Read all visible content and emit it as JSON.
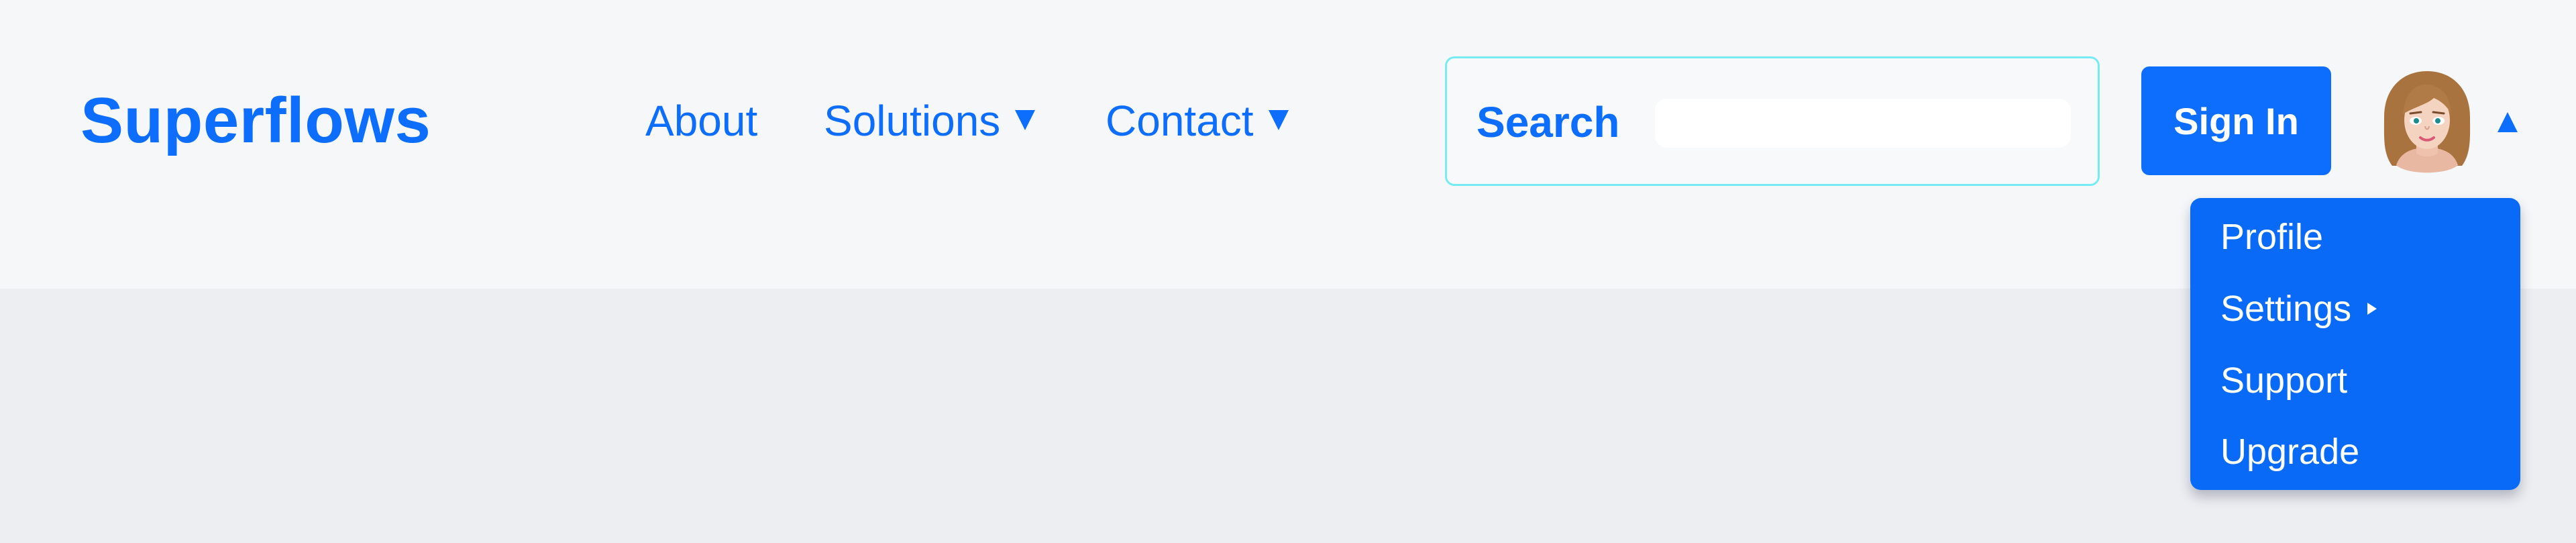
{
  "colors": {
    "accent": "#0d6efd",
    "header_bg": "#f6f7f9",
    "page_bg": "#edeef2",
    "search_border": "#77ebf3",
    "menu_text": "#ffffff"
  },
  "brand": {
    "name": "Superflows"
  },
  "nav": {
    "items": [
      {
        "label": "About",
        "icon": ""
      },
      {
        "label": "Solutions",
        "icon": "caret-down-icon"
      },
      {
        "label": "Contact",
        "icon": "caret-down-icon"
      }
    ]
  },
  "search": {
    "label": "Search",
    "value": "",
    "placeholder": ""
  },
  "auth": {
    "sign_in_label": "Sign In"
  },
  "user_menu": {
    "avatar_icon": "user-avatar",
    "toggle_icon": "caret-up-icon",
    "items": [
      {
        "label": "Profile"
      },
      {
        "label": "Settings",
        "icon": "caret-right-icon"
      },
      {
        "label": "Support"
      },
      {
        "label": "Upgrade"
      }
    ]
  }
}
